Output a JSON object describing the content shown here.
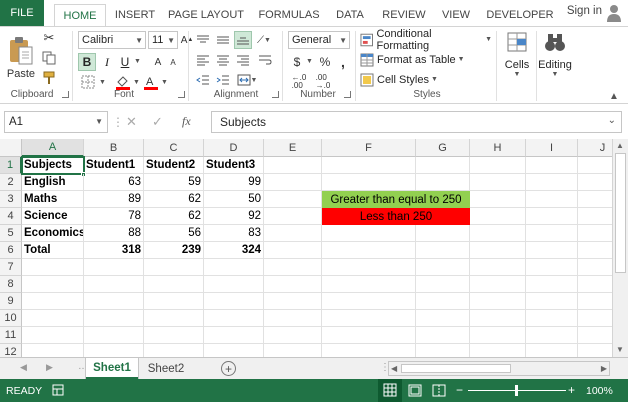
{
  "tabs": {
    "file": "FILE",
    "home": "HOME",
    "insert": "INSERT",
    "page_layout": "PAGE LAYOUT",
    "formulas": "FORMULAS",
    "data": "DATA",
    "review": "REVIEW",
    "view": "VIEW",
    "developer": "DEVELOPER",
    "sign_in": "Sign in"
  },
  "ribbon": {
    "paste": "Paste",
    "clipboard": "Clipboard",
    "font_name": "Calibri",
    "font_size": "11",
    "bold": "B",
    "italic": "I",
    "underline": "U",
    "font": "Font",
    "alignment": "Alignment",
    "number_format": "General",
    "currency": "$",
    "percent": "%",
    "comma": ",",
    "number": "Number",
    "conditional_formatting": "Conditional Formatting",
    "format_as_table": "Format as Table",
    "cell_styles": "Cell Styles",
    "styles": "Styles",
    "cells": "Cells",
    "editing": "Editing"
  },
  "formula_bar": {
    "name_box": "A1",
    "content": "Subjects",
    "fx": "fx"
  },
  "columns": [
    "A",
    "B",
    "C",
    "D",
    "E",
    "F",
    "G",
    "H",
    "I",
    "J"
  ],
  "rows": [
    "1",
    "2",
    "3",
    "4",
    "5",
    "6",
    "7",
    "8",
    "9",
    "10",
    "11",
    "12"
  ],
  "table": {
    "header": [
      "Subjects",
      "Student1",
      "Student2",
      "Student3"
    ],
    "data": [
      [
        "English",
        "63",
        "59",
        "99"
      ],
      [
        "Maths",
        "89",
        "62",
        "50"
      ],
      [
        "Science",
        "78",
        "62",
        "92"
      ],
      [
        "Economics",
        "88",
        "56",
        "83"
      ]
    ],
    "total": [
      "Total",
      "318",
      "239",
      "324"
    ]
  },
  "legend": {
    "green_label": "Greater than equal to 250",
    "red_label": "Less than 250",
    "green_color": "#92d050",
    "red_color": "#ff0000"
  },
  "sheets": {
    "sheet1": "Sheet1",
    "sheet2": "Sheet2"
  },
  "status": {
    "ready": "READY",
    "zoom": "100%"
  }
}
